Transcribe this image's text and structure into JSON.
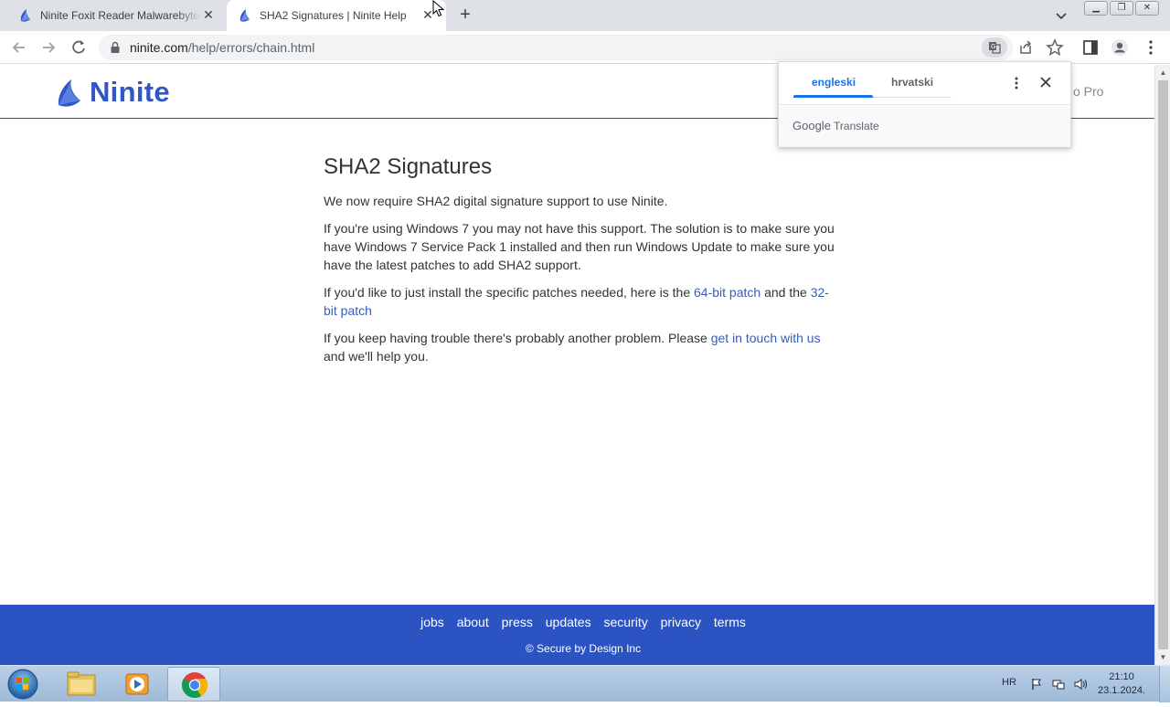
{
  "browser": {
    "tabs": [
      {
        "title": "Ninite Foxit Reader Malwarebytes",
        "active": false
      },
      {
        "title": "SHA2 Signatures | Ninite Help",
        "active": true
      }
    ],
    "new_tab_label": "+",
    "url_host": "ninite.com",
    "url_path": "/help/errors/chain.html"
  },
  "site": {
    "logo_text": "Ninite",
    "header_right_partial": "o Pro"
  },
  "article": {
    "title": "SHA2 Signatures",
    "p1": "We now require SHA2 digital signature support to use Ninite.",
    "p2": "If you're using Windows 7 you may not have this support. The solution is to make sure you have Windows 7 Service Pack 1 installed and then run Windows Update to make sure you have the latest patches to add SHA2 support.",
    "p3_before": "If you'd like to just install the specific patches needed, here is the ",
    "p3_link1": "64-bit patch",
    "p3_middle": " and the ",
    "p3_link2": "32-bit patch",
    "p4_before": "If you keep having trouble there's probably another problem. Please ",
    "p4_link": "get in touch with us",
    "p4_after": " and we'll help you."
  },
  "footer": {
    "links": [
      "jobs",
      "about",
      "press",
      "updates",
      "security",
      "privacy",
      "terms"
    ],
    "copyright": "© Secure by Design Inc"
  },
  "translate_popup": {
    "source_lang": "engleski",
    "target_lang": "hrvatski",
    "brand_google": "Google",
    "brand_translate": "Translate"
  },
  "taskbar": {
    "language": "HR",
    "time": "21:10",
    "date": "23.1.2024."
  },
  "colors": {
    "ninite_blue": "#3056c8",
    "footer_blue": "#2b53c1",
    "link": "#3a5cb8",
    "translate_accent": "#1a73e8"
  }
}
